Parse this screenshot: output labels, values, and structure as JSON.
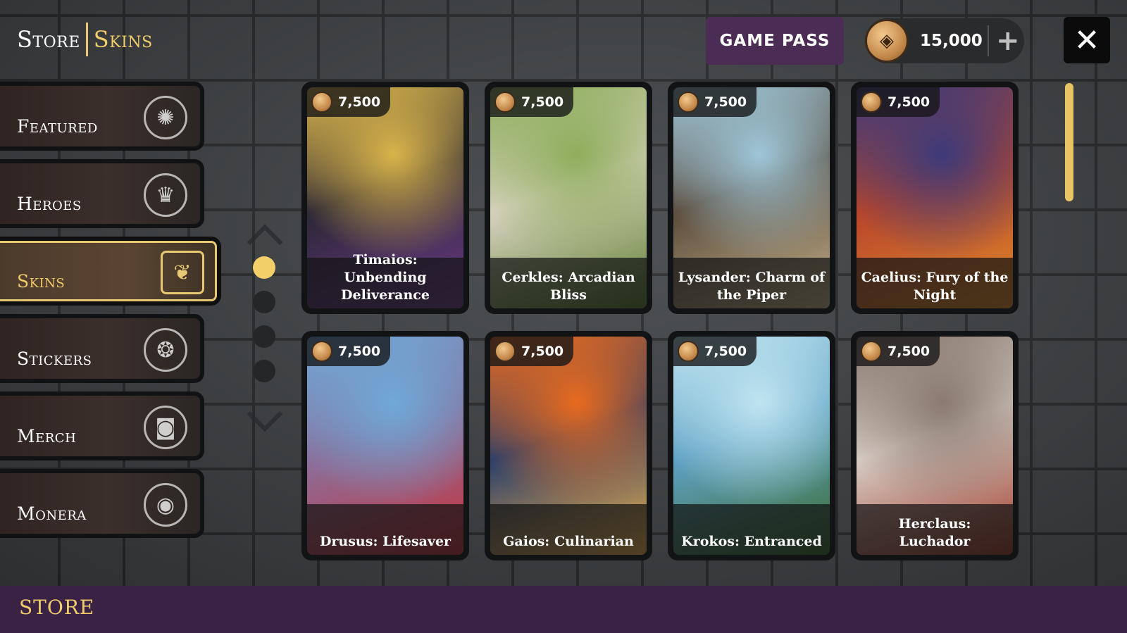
{
  "header": {
    "title_store": "Store",
    "title_skins": "Skins",
    "game_pass_label": "GAME PASS",
    "currency_amount": "15,000",
    "add_currency_glyph": "+",
    "close_glyph": "✕"
  },
  "sidebar": {
    "items": [
      {
        "label": "Featured",
        "icon": "swirl-icon",
        "glyph": "✺",
        "active": false
      },
      {
        "label": "Heroes",
        "icon": "hero-mask-icon",
        "glyph": "♛",
        "active": false
      },
      {
        "label": "Skins",
        "icon": "skins-cat-icon",
        "glyph": "❦",
        "active": true
      },
      {
        "label": "Stickers",
        "icon": "stickers-icon",
        "glyph": "❂",
        "active": false
      },
      {
        "label": "Merch",
        "icon": "merch-bag-icon",
        "glyph": "◙",
        "active": false
      },
      {
        "label": "Monera",
        "icon": "monera-coins-icon",
        "glyph": "◉",
        "active": false
      }
    ]
  },
  "pager": {
    "pages": 4,
    "current": 1
  },
  "skins": [
    {
      "name": "Timaios: Unbending Deliverance",
      "price": "7,500",
      "colors": [
        "#d9b44a",
        "#2b2735",
        "#6d3a8a"
      ]
    },
    {
      "name": "Cerkles: Arcadian Bliss",
      "price": "7,500",
      "colors": [
        "#8fae5c",
        "#d7d2c0",
        "#5c7d2e"
      ]
    },
    {
      "name": "Lysander: Charm of the Piper",
      "price": "7,500",
      "colors": [
        "#9ec6d8",
        "#5a4a3a",
        "#c9b58e"
      ]
    },
    {
      "name": "Caelius: Fury of the Night",
      "price": "7,500",
      "colors": [
        "#3c3a7a",
        "#b8452b",
        "#e08a2a"
      ]
    },
    {
      "name": "Drusus: Lifesaver",
      "price": "7,500",
      "colors": [
        "#6fa9d8",
        "#8a6f9a",
        "#c8303a"
      ]
    },
    {
      "name": "Gaios: Culinarian",
      "price": "7,500",
      "colors": [
        "#e86a1e",
        "#2b3f6a",
        "#f2b24a"
      ]
    },
    {
      "name": "Krokos: Entranced",
      "price": "7,500",
      "colors": [
        "#bfe4f0",
        "#5fa1c4",
        "#3a6a2a"
      ]
    },
    {
      "name": "Herclaus: Luchador",
      "price": "7,500",
      "colors": [
        "#8a7a70",
        "#d6ccc4",
        "#a03a2a"
      ]
    }
  ],
  "footer": {
    "label": "STORE"
  },
  "colors": {
    "accent_gold": "#f0cd6a",
    "game_pass_purple": "#4a2c55",
    "footer_purple": "#3a2244"
  }
}
